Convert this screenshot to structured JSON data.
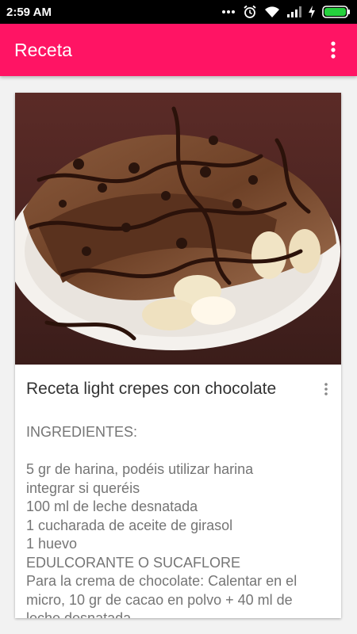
{
  "status_bar": {
    "time": "2:59 AM"
  },
  "app_bar": {
    "title": "Receta",
    "background": "#ff1464"
  },
  "card": {
    "image_description_icon": "crepes-image",
    "title": "Receta light crepes con chocolate",
    "ingredients_header": "INGREDIENTES:",
    "lines": [
      "5 gr de harina, podéis utilizar harina",
      "integrar si queréis",
      "100 ml de leche desnatada",
      "1 cucharada de aceite de girasol",
      "1 huevo",
      "EDULCORANTE O SUCAFLORE",
      "Para la crema de chocolate: Calentar en el",
      "micro, 10 gr de cacao en polvo + 40 ml de",
      "leche desnatada"
    ]
  }
}
